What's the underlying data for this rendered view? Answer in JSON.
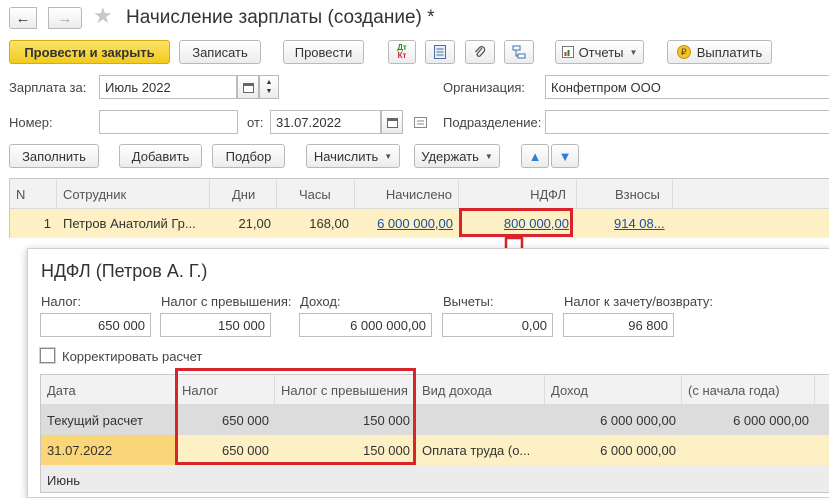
{
  "window": {
    "title": "Начисление зарплаты (создание) *",
    "back_icon": "←",
    "forward_icon": "→",
    "star_icon": "★"
  },
  "toolbar": {
    "post_close": "Провести и закрыть",
    "write": "Записать",
    "post": "Провести",
    "dtkt_top": "Дт",
    "dtkt_bottom": "Кт",
    "reports": "Отчеты",
    "pay": "Выплатить",
    "pay_icon": "₽"
  },
  "form": {
    "salary_for_label": "Зарплата за:",
    "salary_for_value": "Июль 2022",
    "org_label": "Организация:",
    "org_value": "Конфетпром ООО",
    "number_label": "Номер:",
    "number_value": "",
    "from_label": "от:",
    "date_value": "31.07.2022",
    "dept_label": "Подразделение:",
    "dept_value": ""
  },
  "actions": {
    "fill": "Заполнить",
    "add": "Добавить",
    "select": "Подбор",
    "accrue": "Начислить",
    "withhold": "Удержать",
    "up_icon": "▲",
    "down_icon": "▼"
  },
  "grid": {
    "columns": [
      "N",
      "Сотрудник",
      "Дни",
      "Часы",
      "Начислено",
      "НДФЛ",
      "Взносы"
    ],
    "rows": [
      {
        "n": "1",
        "employee": "Петров Анатолий Гр...",
        "days": "21,00",
        "hours": "168,00",
        "accrued": "6 000 000,00",
        "ndfl": "800 000,00",
        "contrib": "914 08..."
      }
    ]
  },
  "popup": {
    "title": "НДФЛ (Петров А. Г.)",
    "tax_label": "Налог:",
    "tax_value": "650 000",
    "excess_label": "Налог с превышения:",
    "excess_value": "150 000",
    "income_label": "Доход:",
    "income_value": "6 000 000,00",
    "deductions_label": "Вычеты:",
    "deductions_value": "0,00",
    "offset_label": "Налог к зачету/возврату:",
    "offset_value": "96 800",
    "correct_label": "Корректировать расчет",
    "columns": [
      "Дата",
      "Налог",
      "Налог с превышения",
      "Вид дохода",
      "Доход",
      "(с начала года)"
    ],
    "rows": [
      {
        "date": "Текущий расчет",
        "tax": "650 000",
        "excess": "150 000",
        "kind": "",
        "income": "6 000 000,00",
        "ytd": "6 000 000,00"
      },
      {
        "date": "31.07.2022",
        "tax": "650 000",
        "excess": "150 000",
        "kind": "Оплата труда (о...",
        "income": "6 000 000,00",
        "ytd": ""
      },
      {
        "date": "Июнь",
        "tax": "",
        "excess": "",
        "kind": "",
        "income": "",
        "ytd": ""
      }
    ]
  },
  "colors": {
    "accent_yellow": "#f5d12b",
    "highlight_red": "#d8242b",
    "selected_row": "#fdf0c4",
    "link": "#1a4fa0"
  }
}
